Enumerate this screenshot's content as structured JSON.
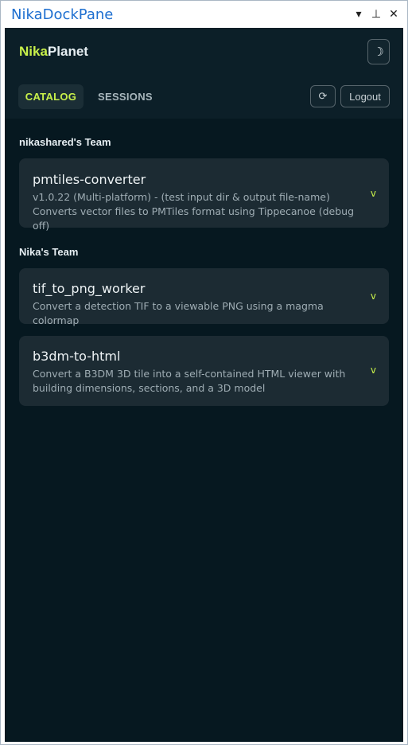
{
  "window": {
    "title": "NikaDockPane",
    "controls": {
      "dropdown": "▾",
      "pin": "⊥",
      "close": "✕"
    }
  },
  "header": {
    "brand_a": "Nika",
    "brand_b": "Planet",
    "theme_icon": "☽",
    "tabs": [
      {
        "label": "CATALOG",
        "active": true
      },
      {
        "label": "SESSIONS",
        "active": false
      }
    ],
    "refresh_icon": "⟳",
    "logout_label": "Logout"
  },
  "teams": [
    {
      "label": "nikashared's Team",
      "items": [
        {
          "name": "pmtiles-converter",
          "description": "v1.0.22 (Multi-platform) - (test input dir & output file-name) Converts vector files to PMTiles format using Tippecanoe (debug off)",
          "chevron": "v"
        }
      ]
    },
    {
      "label": "Nika's Team",
      "items": [
        {
          "name": "tif_to_png_worker",
          "description": "Convert a detection TIF to a viewable PNG using a magma colormap",
          "chevron": "v"
        },
        {
          "name": "b3dm-to-html",
          "description": "Convert a B3DM 3D tile into a self-contained HTML viewer with building dimensions, sections, and a 3D model",
          "chevron": "v"
        }
      ]
    }
  ],
  "colors": {
    "accent": "#c8f04a",
    "pane_bg": "#061820",
    "card_bg": "#1c2b33",
    "title_blue": "#1e6fd0"
  }
}
